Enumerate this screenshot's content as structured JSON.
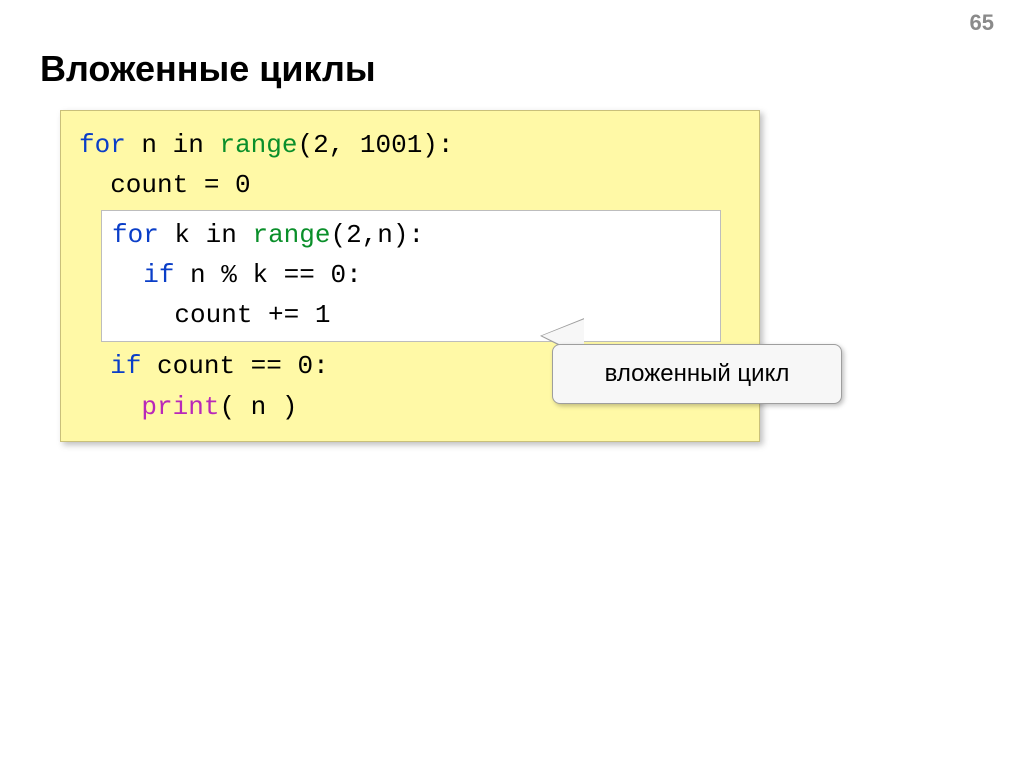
{
  "page_number": "65",
  "title": "Вложенные циклы",
  "code": {
    "line1": {
      "for": "for",
      "var": "n",
      "in": "in",
      "range": "range",
      "args": "(2, 1001):"
    },
    "line2": "  count = 0",
    "inner": {
      "line1": {
        "for": "for",
        "var": "k",
        "in": "in",
        "range": "range",
        "args": "(2,n):"
      },
      "line2": {
        "if": "if",
        "rest": " n % k == 0:"
      },
      "line3": "    count += 1"
    },
    "line_after1": {
      "if": "if",
      "rest": " count == 0:"
    },
    "line_after2": {
      "print": "print",
      "rest": "( n )"
    }
  },
  "callout_text": "вложенный цикл"
}
